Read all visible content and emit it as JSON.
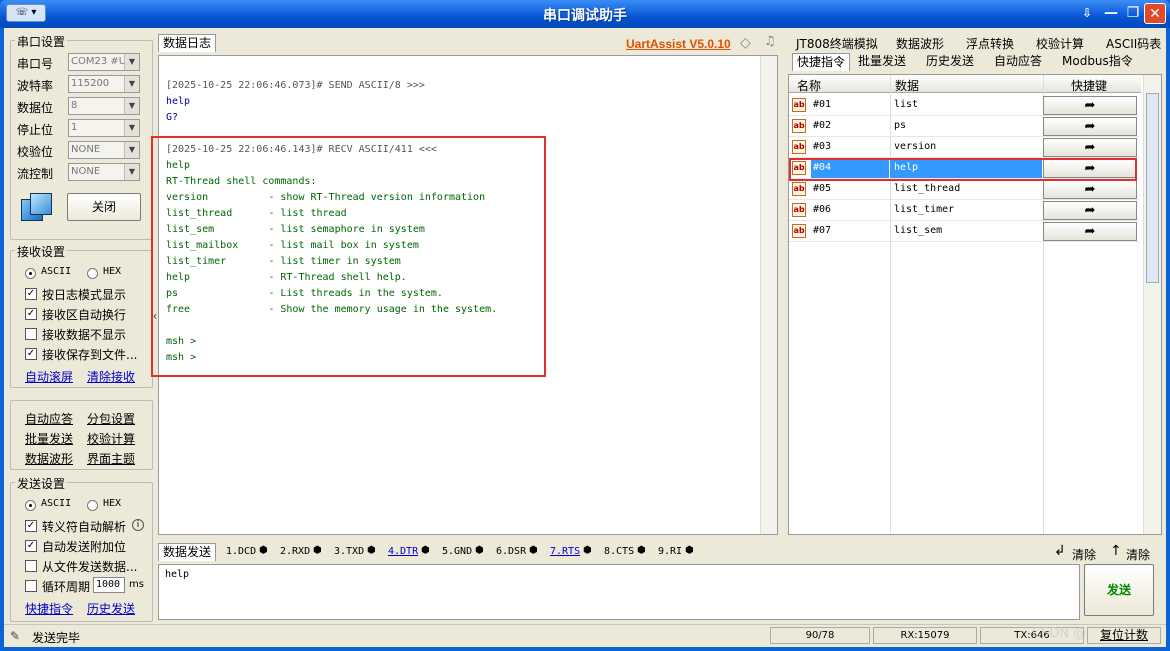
{
  "window": {
    "title": "串口调试助手",
    "sys_menu": "☏ ▾",
    "buttons": {
      "pin": "⇩",
      "minimize": "—",
      "restore": "❐",
      "close": "✕"
    }
  },
  "serial": {
    "group_title": "串口设置",
    "port_label": "串口号",
    "port_value": "COM23 #US",
    "baud_label": "波特率",
    "baud_value": "115200",
    "data_label": "数据位",
    "data_value": "8",
    "stop_label": "停止位",
    "stop_value": "1",
    "parity_label": "校验位",
    "parity_value": "NONE",
    "flow_label": "流控制",
    "flow_value": "NONE",
    "close_button": "关闭"
  },
  "receive": {
    "group_title": "接收设置",
    "ascii": "ASCII",
    "hex": "HEX",
    "log_mode": "按日志模式显示",
    "auto_wrap": "接收区自动换行",
    "hide_data": "接收数据不显示",
    "save_file": "接收保存到文件...",
    "auto_scroll": "自动滚屏",
    "clear_recv": "清除接收"
  },
  "tools": {
    "auto_reply": "自动应答",
    "packet_settings": "分包设置",
    "batch_send": "批量发送",
    "checksum": "校验计算",
    "waveform": "数据波形",
    "theme": "界面主题"
  },
  "send_settings": {
    "group_title": "发送设置",
    "ascii": "ASCII",
    "hex": "HEX",
    "escape_parse": "转义符自动解析",
    "auto_append": "自动发送附加位",
    "from_file": "从文件发送数据...",
    "loop_period": "循环周期",
    "loop_value": "1000",
    "loop_unit": "ms",
    "quick_cmd": "快捷指令",
    "history": "历史发送"
  },
  "log": {
    "tab": "数据日志",
    "brand": "UartAssist V5.0.10",
    "lines": [
      {
        "cls": "hdr",
        "text": "[2025-10-25 22:06:46.073]# SEND ASCII/8 >>>"
      },
      {
        "cls": "sent",
        "text": "help"
      },
      {
        "cls": "sent",
        "text": "G?"
      },
      {
        "cls": "hdr",
        "text": ""
      },
      {
        "cls": "hdr",
        "text": "[2025-10-25 22:06:46.143]# RECV ASCII/411 <<<"
      },
      {
        "cls": "recv",
        "text": "help"
      },
      {
        "cls": "recv",
        "text": "RT-Thread shell commands:"
      },
      {
        "cls": "recv",
        "text": "version          - show RT-Thread version information"
      },
      {
        "cls": "recv",
        "text": "list_thread      - list thread"
      },
      {
        "cls": "recv",
        "text": "list_sem         - list semaphore in system"
      },
      {
        "cls": "recv",
        "text": "list_mailbox     - list mail box in system"
      },
      {
        "cls": "recv",
        "text": "list_timer       - list timer in system"
      },
      {
        "cls": "recv",
        "text": "help             - RT-Thread shell help."
      },
      {
        "cls": "recv",
        "text": "ps               - List threads in the system."
      },
      {
        "cls": "recv",
        "text": "free             - Show the memory usage in the system."
      },
      {
        "cls": "recv",
        "text": ""
      },
      {
        "cls": "recv",
        "text": "msh >"
      },
      {
        "cls": "recv",
        "text": "msh >"
      }
    ]
  },
  "right_tabs": {
    "row1": [
      "JT808终端模拟",
      "数据波形",
      "浮点转换",
      "校验计算",
      "ASCII码表"
    ],
    "row2": [
      "快捷指令",
      "批量发送",
      "历史发送",
      "自动应答",
      "Modbus指令"
    ]
  },
  "grid": {
    "headers": {
      "name": "名称",
      "data": "数据",
      "shortcut": "快捷键"
    },
    "icon_text": "ab",
    "send_arrow": "➦",
    "rows": [
      {
        "id": "#01",
        "data": "list"
      },
      {
        "id": "#02",
        "data": "ps"
      },
      {
        "id": "#03",
        "data": "version"
      },
      {
        "id": "#04",
        "data": "help"
      },
      {
        "id": "#05",
        "data": "list_thread"
      },
      {
        "id": "#06",
        "data": "list_timer"
      },
      {
        "id": "#07",
        "data": "list_sem"
      }
    ],
    "selected_index": 3
  },
  "send": {
    "tab": "数据发送",
    "signals": [
      "1.DCD",
      "2.RXD",
      "3.TXD",
      "4.DTR",
      "5.GND",
      "6.DSR",
      "7.RTS",
      "8.CTS",
      "9.RI"
    ],
    "clear1": "清除",
    "clear2": "清除",
    "text": "help",
    "send_button": "发送"
  },
  "status": {
    "message": "发送完毕",
    "count": "90/78",
    "rx": "RX:15079",
    "tx": "TX:646",
    "reset": "复位计数"
  },
  "watermark": "CSDN @",
  "colors": {
    "accent": "#0a64d8",
    "selected": "#3399ff",
    "highlight": "#e03030",
    "brand": "#e05000",
    "send_text": "#080"
  }
}
